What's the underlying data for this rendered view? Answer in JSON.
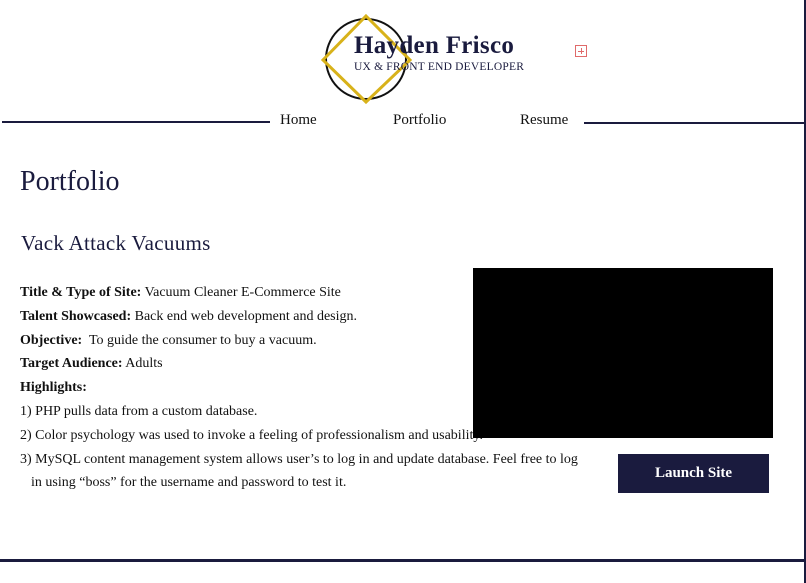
{
  "logo": {
    "name": "Hayden Frisco",
    "subtitle": "UX & FRONT END DEVELOPER"
  },
  "nav": {
    "items": [
      {
        "label": "Home"
      },
      {
        "label": "Portfolio"
      },
      {
        "label": "Resume"
      }
    ]
  },
  "page": {
    "title": "Portfolio"
  },
  "project": {
    "title": "Vack Attack Vacuums",
    "fields": [
      {
        "label": "Title & Type of Site:",
        "value": " Vacuum Cleaner E-Commerce Site"
      },
      {
        "label": "Talent Showcased:",
        "value": " Back end web development and design."
      },
      {
        "label": "Objective:",
        "value": "  To guide the consumer to buy a vacuum."
      },
      {
        "label": "Target Audience:",
        "value": " Adults"
      }
    ],
    "highlights_label": "Highlights:",
    "highlights": [
      "1) PHP pulls data from a custom database.",
      "2) Color psychology was used to invoke a feeling of professionalism and usability.",
      "3) MySQL content management system allows user’s to log in and update database. Feel free to log",
      "in using “boss” for the username and password to test it."
    ],
    "launch_label": "Launch Site"
  },
  "colors": {
    "navy": "#1a1b3e",
    "gold": "#d8b21a",
    "broken_image": "#e06a6a"
  }
}
